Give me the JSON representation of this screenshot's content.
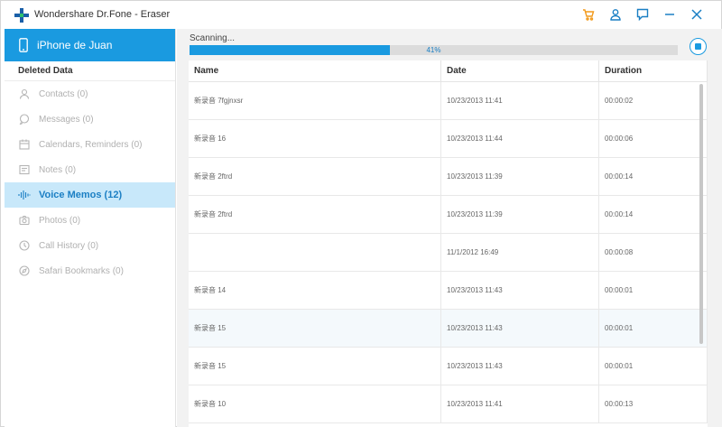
{
  "app": {
    "title": "Wondershare Dr.Fone - Eraser"
  },
  "sidebar": {
    "device_name": "iPhone de Juan",
    "section_label": "Deleted Data",
    "items": [
      {
        "label": "Contacts (0)",
        "icon": "person-icon"
      },
      {
        "label": "Messages (0)",
        "icon": "message-icon"
      },
      {
        "label": "Calendars, Reminders (0)",
        "icon": "calendar-icon"
      },
      {
        "label": "Notes (0)",
        "icon": "notes-icon"
      },
      {
        "label": "Voice Memos (12)",
        "icon": "waveform-icon",
        "active": true
      },
      {
        "label": "Photos (0)",
        "icon": "camera-icon"
      },
      {
        "label": "Call History (0)",
        "icon": "clock-icon"
      },
      {
        "label": "Safari Bookmarks (0)",
        "icon": "compass-icon"
      }
    ]
  },
  "scan": {
    "status": "Scanning...",
    "progress": 41,
    "progress_text": "41%"
  },
  "table": {
    "headers": {
      "name": "Name",
      "date": "Date",
      "duration": "Duration"
    },
    "rows": [
      {
        "name": "新录音 7fgjnxsr",
        "date": "10/23/2013 11:41",
        "duration": "00:00:02"
      },
      {
        "name": "新录音 16",
        "date": "10/23/2013 11:44",
        "duration": "00:00:06"
      },
      {
        "name": "新录音 2ftrd",
        "date": "10/23/2013 11:39",
        "duration": "00:00:14"
      },
      {
        "name": "新录音 2ftrd",
        "date": "10/23/2013 11:39",
        "duration": "00:00:14"
      },
      {
        "name": "",
        "date": "11/1/2012 16:49",
        "duration": "00:00:08"
      },
      {
        "name": "新录音 14",
        "date": "10/23/2013 11:43",
        "duration": "00:00:01"
      },
      {
        "name": "新录音 15",
        "date": "10/23/2013 11:43",
        "duration": "00:00:01"
      },
      {
        "name": "新录音 15",
        "date": "10/23/2013 11:43",
        "duration": "00:00:01"
      },
      {
        "name": "新录音 10",
        "date": "10/23/2013 11:41",
        "duration": "00:00:13"
      }
    ]
  },
  "colors": {
    "accent": "#1a9ae0",
    "active_bg": "#c8e8fa",
    "cart_icon": "#f29a1b"
  }
}
